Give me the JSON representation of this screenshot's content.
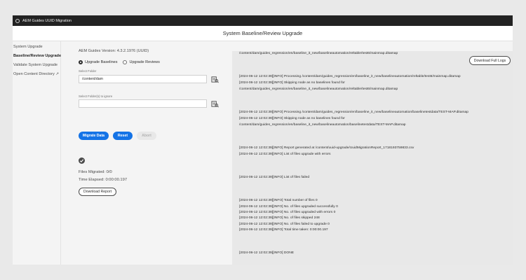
{
  "window": {
    "title": "AEM Guides UUID Migration"
  },
  "header": {
    "title": "System Baseline/Review Upgrade"
  },
  "sidebar": {
    "items": [
      {
        "label": "System Upgrade"
      },
      {
        "label": "Baseline/Review Upgrade"
      },
      {
        "label": "Validate System Upgrade"
      },
      {
        "label": "Open Content Directory ↗"
      }
    ]
  },
  "form": {
    "version": "AEM Guides Version: 4.3.2.1976 (UUID)",
    "radios": [
      {
        "label": "Upgrade Baselines",
        "checked": true
      },
      {
        "label": "Upgrade Reviews",
        "checked": false
      }
    ],
    "select_folder_label": "Select Folder",
    "select_folder_value": "/content/dam",
    "ignore_folder_label": "Select Folder(s) to ignore",
    "ignore_folder_value": "",
    "buttons": {
      "migrate": "Migrate Data",
      "reset": "Reset",
      "abort": "Abort"
    },
    "files_migrated": "Files Migrated:  0/0",
    "time_elapsed": "Time Elapsed:  0:00:00.197",
    "download_report": "Download Report"
  },
  "logs": {
    "download_button": "Download Full Logs",
    "lines": [
      "/content/dam/guides_regression/en/baseline_it_new/baselineautomation/reltable/test6/mainmap.ditamap",
      "[2024-06-12 12:02:39][INFO] Processing /content/dam/guides_regression/en/baseline_it_new/baselineautomation/reltable/test6/mainmap.ditamap",
      "[2024-06-12 12:02:39][INFO] Skipping node as no baselines found for",
      "/content/dam/guides_regression/en/baseline_it_new/baselineautomation/reltable/test6/mainmap.ditamap",
      "[2024-06-12 12:02:39][INFO] Processing /content/dam/guides_regression/en/baseline_it_new/baselineautomation/baselinetestdata/TEST-MAP.ditamap",
      "[2024-06-12 12:02:39][INFO] Skipping node as no baselines found for",
      "/content/dam/guides_regression/en/baseline_it_new/baselineautomation/baselinetestdata/TEST-MAP.ditamap",
      "[2024-06-12 12:02:39][INFO] Report generated at /content/uuid-upgrade/UuidMigrationReport_1718193759833.csv",
      "[2024-06-12 12:02:39][INFO] List of files upgrade with errors",
      "[2024-06-12 12:02:39][INFO] List of files failed",
      "[2024-06-12 12:02:39][INFO] Total number of files 0",
      "[2024-06-12 12:02:39][INFO] No. of files upgraded successfully 0",
      "[2024-06-12 12:02:39][INFO] No. of files upgraded with errors 0",
      "[2024-06-12 12:02:39][INFO] No. of files skipped 248",
      "[2024-06-12 12:02:39][INFO] No. of files failed to upgrade 0",
      "[2024-06-12 12:02:39][INFO] Total time taken: 0:00:00.197",
      "[2024-06-12 12:02:39][INFO] DONE"
    ]
  },
  "icons": {
    "app": "app-icon",
    "browse": "folder-browse-icon",
    "status": "checkmark-circle-icon"
  },
  "colors": {
    "accent": "#1473e6",
    "titlebar": "#222222"
  }
}
